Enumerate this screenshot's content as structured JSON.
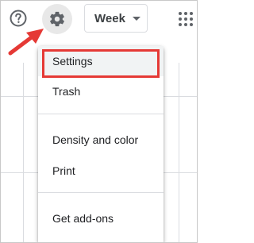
{
  "toolbar": {
    "help_icon": "help-circle-icon",
    "settings_icon": "gear-icon",
    "view_select": {
      "selected": "Week"
    },
    "apps_icon": "apps-grid-icon"
  },
  "menu": {
    "items": [
      {
        "label": "Settings"
      },
      {
        "label": "Trash"
      },
      {
        "label": "Density and color"
      },
      {
        "label": "Print"
      },
      {
        "label": "Get add-ons"
      }
    ]
  },
  "colors": {
    "annotation_red": "#e53935",
    "icon_gray": "#5f6368",
    "text": "#202124",
    "highlight_bg": "#f1f3f4"
  }
}
